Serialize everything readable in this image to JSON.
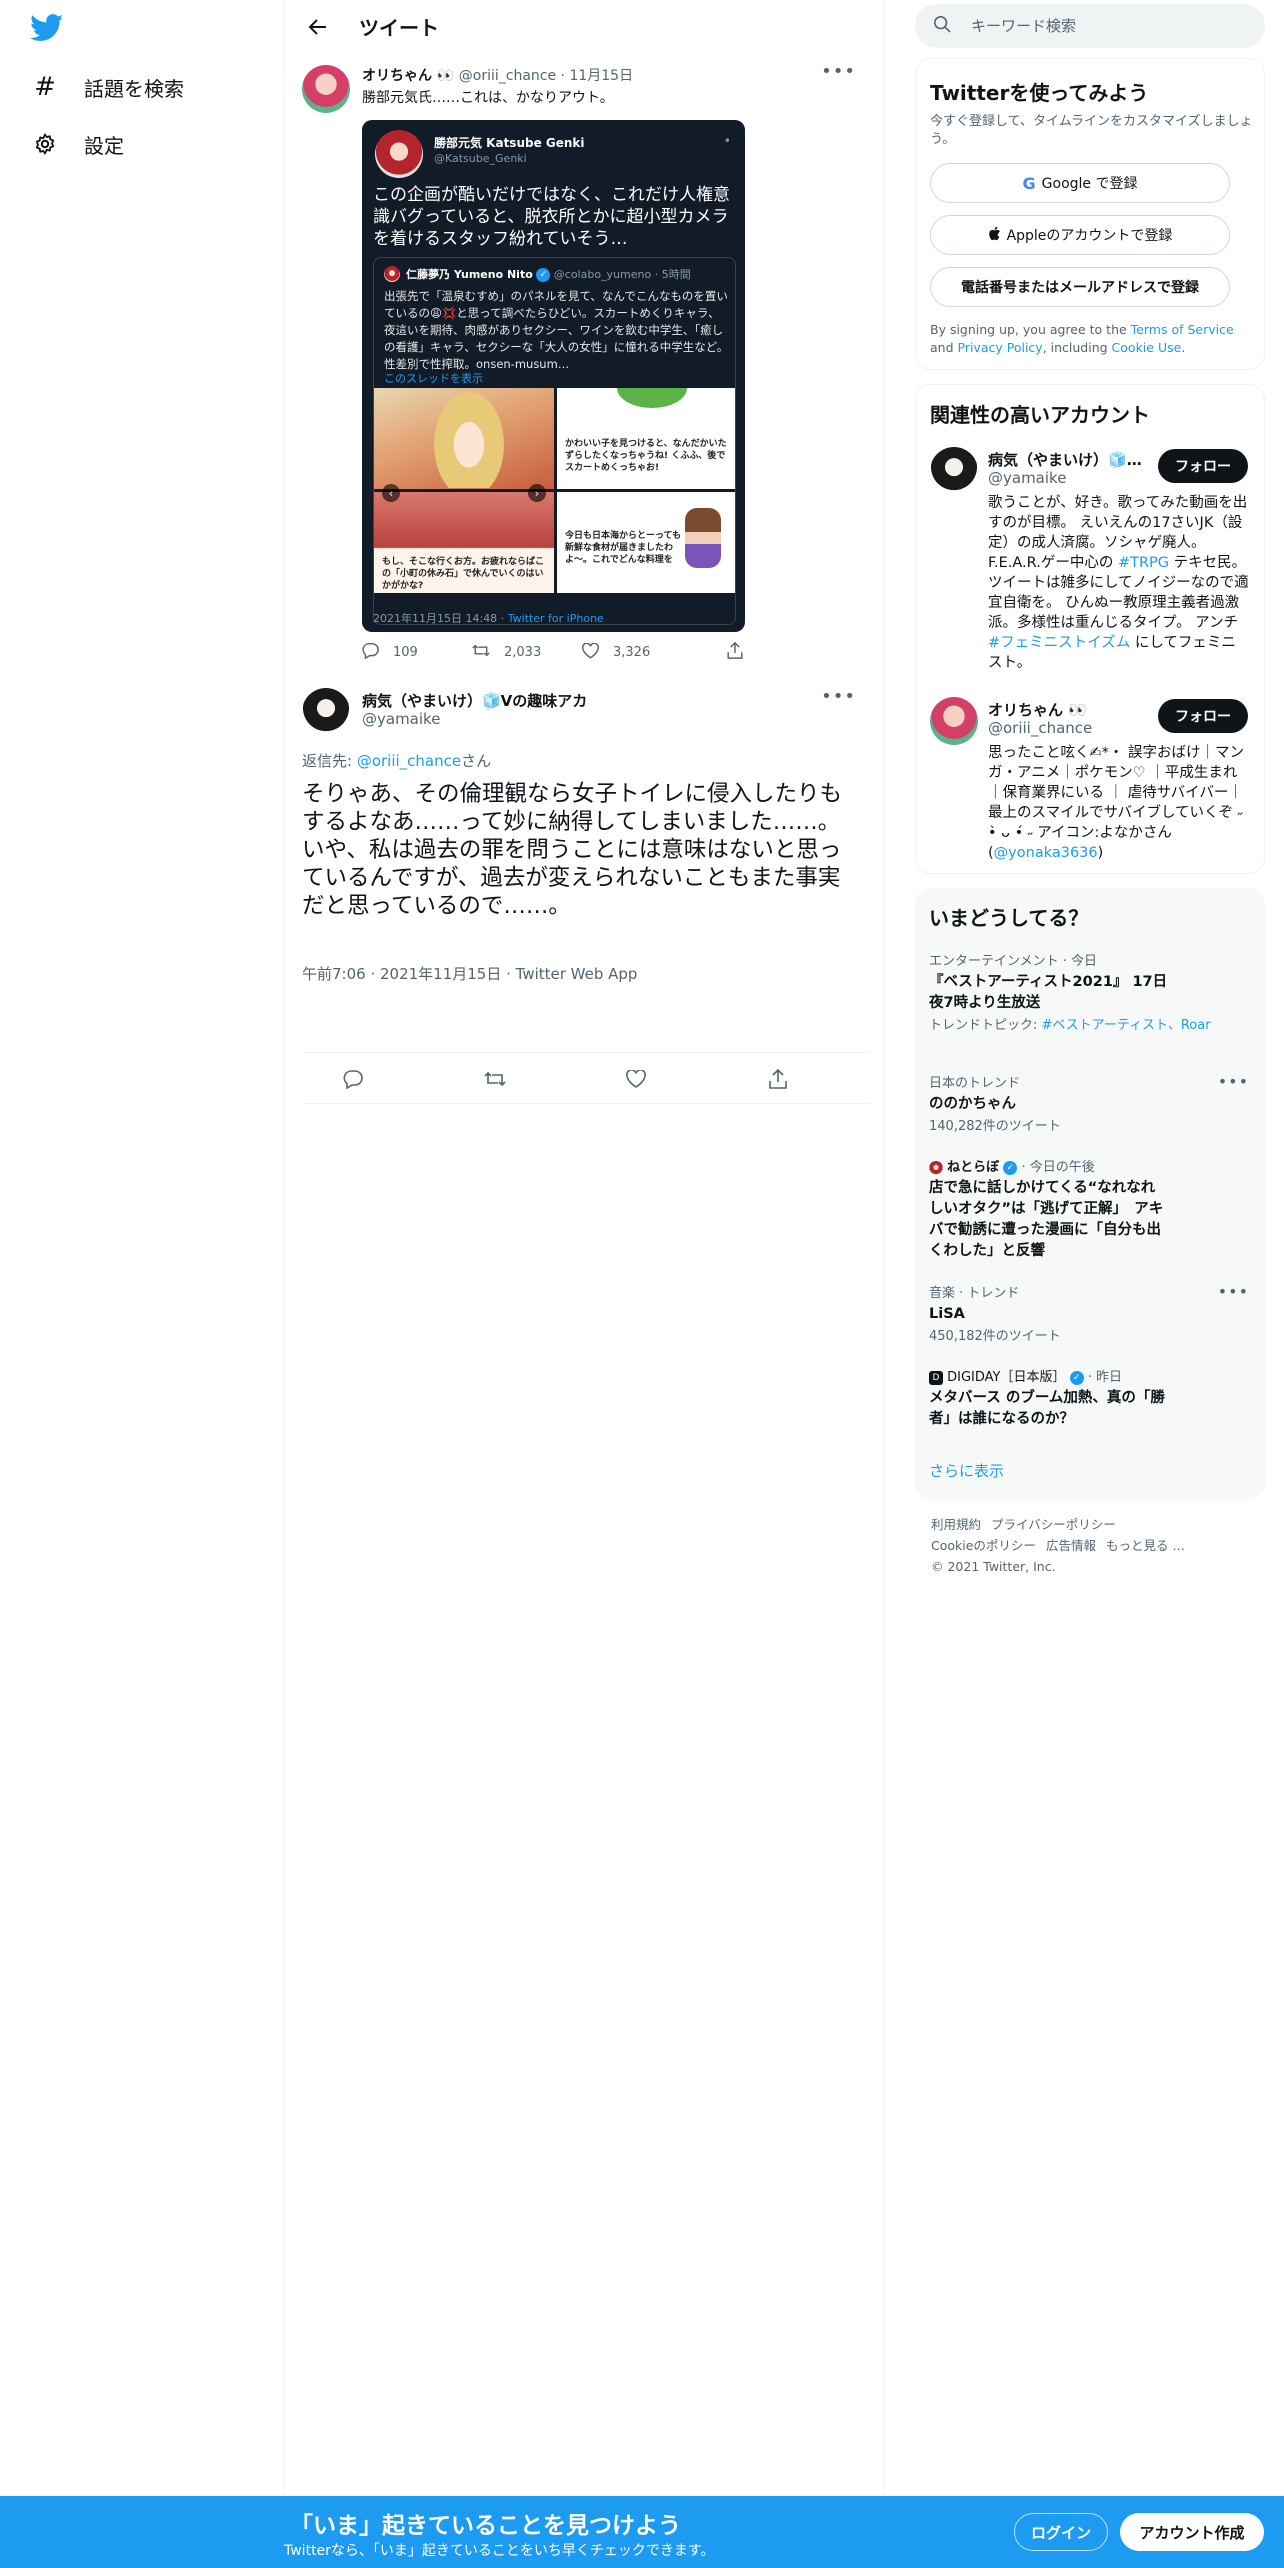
{
  "nav": {
    "logo_icon": "twitter-bird-icon",
    "brand_color": "#1d9bf0",
    "items": [
      {
        "icon": "hashtag-icon",
        "label": "話題を検索"
      },
      {
        "icon": "gear-icon",
        "label": "設定"
      }
    ]
  },
  "main": {
    "title": "ツイート",
    "quoted_tweet": {
      "name": "オリちゃん 👀",
      "handle": "@oriii_chance",
      "date": "11月15日",
      "text": "勝部元気氏……これは、かなりアウト。",
      "embed": {
        "name": "勝部元気 Katsube Genki",
        "handle": "@Katsube_Genki",
        "text": "この企画が酷いだけではなく、これだけ人権意識バグっていると、脱衣所とかに超小型カメラを着けるスタッフ紛れていそう…",
        "inner": {
          "name": "仁藤夢乃 Yumeno Nito",
          "handle": "@colabo_yumeno",
          "time": "5時間",
          "text": "出張先で「温泉むすめ」のパネルを見て、なんでこんなものを置いているの😩💢と思って調べたらひどい。スカートめくりキャラ、夜這いを期待、肉感がありセクシー、ワインを飲む中学生、「癒しの看護」キャラ、セクシーな「大人の女性」に憧れる中学生など。性差別で性搾取。onsen-musum…",
          "show_thread": "このスレッドを表示",
          "img_texts": {
            "c2": "かわいい子を見つけると、なんだかいたずらしたくなっちゃうね! くふふ、後でスカートめくっちゃお!",
            "c3": "もし、そこな行くお方。お疲れならばこの「小町の休み石」で休んでいくのはいかがかな?",
            "c4": "今日も日本海からとーっても新鮮な食材が届きましたわよ〜。これでどんな料理を"
          }
        },
        "time": "2021年11月15日 14:48",
        "source": "Twitter for iPhone"
      },
      "replies": "109",
      "retweets": "2,033",
      "likes": "3,326"
    },
    "tweet": {
      "name": "病気（やまいけ）🧊Vの趣味アカ",
      "handle": "@yamaike",
      "reply_prefix": "返信先: ",
      "reply_to": "@oriii_chance",
      "reply_suffix": "さん",
      "text": "そりゃあ、その倫理観なら女子トイレに侵入したりもするよなあ……って妙に納得してしまいました……。\nいや、私は過去の罪を問うことには意味はないと思っているんですが、過去が変えられないこともまた事実だと思っているので……。",
      "meta": "午前7:06 · 2021年11月15日 · Twitter Web App"
    }
  },
  "sidebar": {
    "search_placeholder": "キーワード検索",
    "signup": {
      "title": "Twitterを使ってみよう",
      "subtitle": "今すぐ登録して、タイムラインをカスタマイズしましょう。",
      "google": "Google で登録",
      "apple": "Appleのアカウントで登録",
      "phone": "電話番号またはメールアドレスで登録",
      "legal_1": "By signing up, you agree to the ",
      "tos": "Terms of Service",
      "legal_2": " and ",
      "privacy": "Privacy Policy",
      "legal_3": ", including ",
      "cookie": "Cookie Use",
      "legal_4": "."
    },
    "related": {
      "title": "関連性の高いアカウント",
      "follow_label": "フォロー",
      "users": [
        {
          "name": "病気（やまいけ）🧊Vの趣味アカ",
          "handle": "@yamaike",
          "bio_1": "歌うことが、好き。歌ってみた動画を出すのが目標。 えいえんの17さいJK（設定）の成人済腐。ソシャゲ廃人。F.E.A.R.ゲー中心の ",
          "bio_link_1": "#TRPG",
          "bio_2": " テキセ民。 ツイートは雑多にしてノイジーなので適宜自衛を。 ひんぬー教原理主義者過激派。多様性は重んじるタイプ。 アンチ ",
          "bio_link_2": "#フェミニストイズム",
          "bio_3": " にしてフェミニスト。"
        },
        {
          "name": "オリちゃん 👀",
          "handle": "@oriii_chance",
          "bio_1": "思ったこと呟く✍︎*・ 誤字おばけ｜マンガ・アニメ｜ポケモン♡ ｜平成生まれ ｜保育業界にいる ｜ 虐待サバイバー｜最上のスマイルでサバイブしていくぞ ˶ •̀ ᴗ •́ ˶ アイコン:よなかさん(",
          "bio_link_1": "@yonaka3636",
          "bio_2": ")"
        }
      ]
    },
    "trends": {
      "title": "いまどうしてる？",
      "items": [
        {
          "meta": "エンターテインメント · 今日",
          "name": "『ベストアーティスト2021』 17日夜7時より生放送",
          "sub_1": "トレンドトピック: ",
          "sub_link": "#ベストアーティスト",
          "sub_2": "、Roar"
        },
        {
          "meta": "日本のトレンド",
          "name": "ののかちゃん",
          "sub_1": "140,282件のツイート"
        },
        {
          "source": "ねとらぼ",
          "meta": "今日の午後",
          "name": "店で急に話しかけてくる“なれなれしいオタク”は「逃げて正解」　アキバで勧誘に遭った漫画に「自分も出くわした」と反響"
        },
        {
          "meta": "音楽 · トレンド",
          "name": "LiSA",
          "sub_1": "450,182件のツイート"
        },
        {
          "source": "DIGIDAY［日本版］",
          "meta": "昨日",
          "name": "メタバース のブーム加熱、真の「勝者」は誰になるのか？"
        }
      ],
      "show_more": "さらに表示"
    },
    "footer": {
      "terms": "利用規約",
      "privacy": "プライバシーポリシー",
      "cookie": "Cookieのポリシー",
      "ads": "広告情報",
      "more": "もっと見る …",
      "copyright": "© 2021 Twitter, Inc."
    }
  },
  "bottombar": {
    "title": "「いま」起きていることを見つけよう",
    "subtitle": "Twitterなら、「いま」起きていることをいち早くチェックできます。",
    "login": "ログイン",
    "signup": "アカウント作成"
  }
}
